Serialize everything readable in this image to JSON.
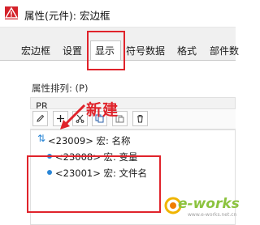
{
  "window": {
    "title": "属性(元件): 宏边框"
  },
  "tabs": [
    {
      "label": "宏边框",
      "active": false
    },
    {
      "label": "设置",
      "active": false
    },
    {
      "label": "显示",
      "active": true
    },
    {
      "label": "符号数据",
      "active": false
    },
    {
      "label": "格式",
      "active": false
    },
    {
      "label": "部件数",
      "active": false
    }
  ],
  "properties": {
    "order_label": "属性排列: (P)",
    "order_value": "PR"
  },
  "annotation": {
    "text": "新建"
  },
  "toolbar": {
    "buttons": [
      {
        "icon": "pencil-icon",
        "glyph": "✎"
      },
      {
        "icon": "plus-icon",
        "glyph": "+"
      },
      {
        "icon": "cut-icon",
        "glyph": "✂"
      },
      {
        "icon": "copy-icon",
        "glyph": "❐"
      },
      {
        "icon": "paste-icon",
        "glyph": "📋"
      },
      {
        "icon": "delete-icon",
        "glyph": "🗑"
      }
    ]
  },
  "tree": {
    "sort_icon": "sort-icon",
    "items": [
      {
        "label": "<23009> 宏: 名称"
      },
      {
        "label": "<23008> 宏: 变量"
      },
      {
        "label": "<23001> 宏: 文件名"
      }
    ]
  },
  "watermark": {
    "text": "e-works",
    "sub": "www.e-works.net.cn"
  },
  "colors": {
    "highlight": "#e0232b",
    "accent": "#2a86d6",
    "watermark": "#8cc33f"
  }
}
